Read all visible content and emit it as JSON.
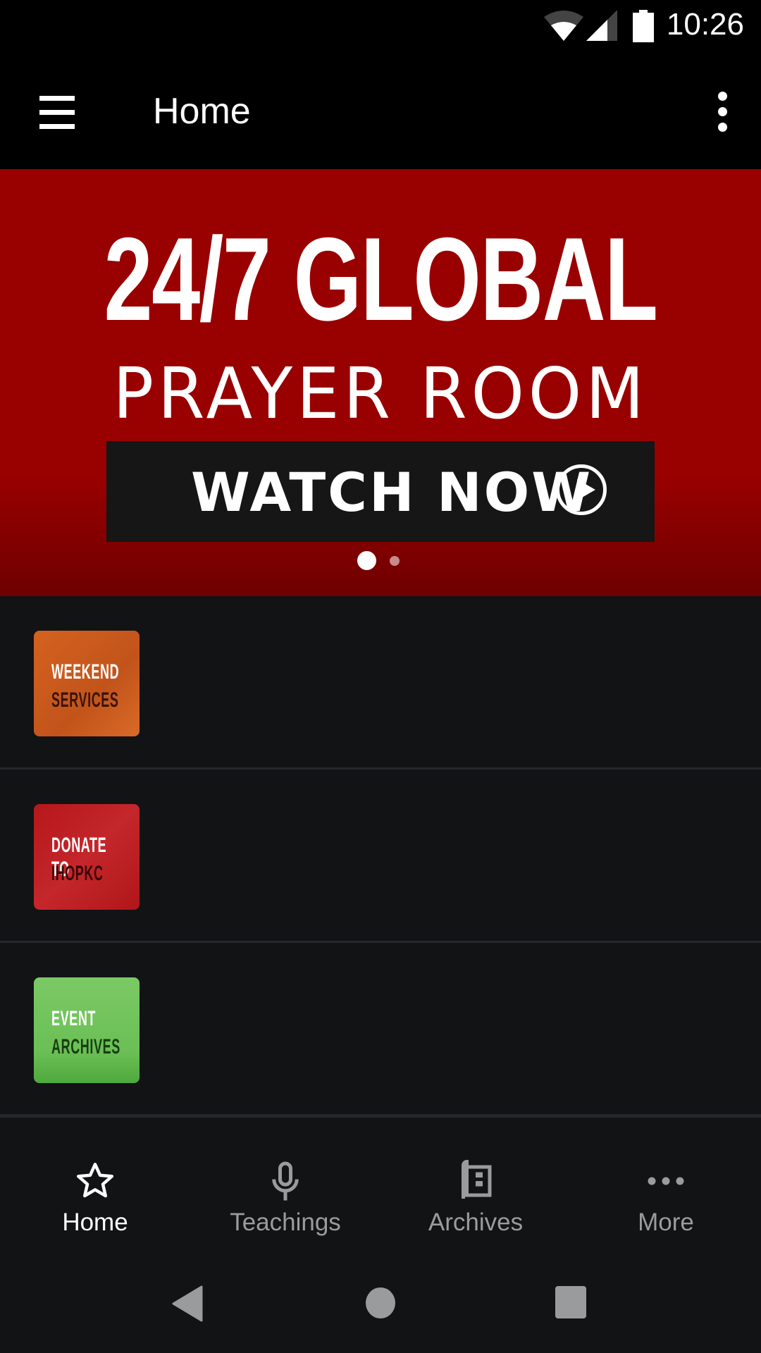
{
  "status_bar": {
    "time": "10:26",
    "icons": [
      "wifi-icon",
      "cell-signal-icon",
      "battery-icon"
    ]
  },
  "app_bar": {
    "title": "Home",
    "menu_icon": "hamburger-menu-icon",
    "overflow_icon": "more-vert-icon"
  },
  "banner": {
    "headline": "24/7 GLOBAL",
    "subheadline": "PRAYER ROOM",
    "button_label": "WATCH NOW",
    "button_icon": "play-circle-icon",
    "pager": {
      "count": 2,
      "active_index": 0
    },
    "colors": {
      "background": "#990000",
      "button": "#161616"
    }
  },
  "list": {
    "items": [
      {
        "line1": "WEEKEND",
        "line2": "SERVICES",
        "color": "#d4621f"
      },
      {
        "line1": "DONATE TO",
        "line2": "IHOPKC",
        "color": "#b5171b"
      },
      {
        "line1": "EVENT",
        "line2": "ARCHIVES",
        "color": "#6bbf55"
      }
    ]
  },
  "bottom_nav": {
    "tabs": [
      {
        "label": "Home",
        "icon": "star-icon",
        "active": true
      },
      {
        "label": "Teachings",
        "icon": "microphone-icon",
        "active": false
      },
      {
        "label": "Archives",
        "icon": "book-icon",
        "active": false
      },
      {
        "label": "More",
        "icon": "more-horiz-icon",
        "active": false
      }
    ]
  },
  "system_nav": {
    "buttons": [
      "back",
      "home",
      "recents"
    ]
  }
}
